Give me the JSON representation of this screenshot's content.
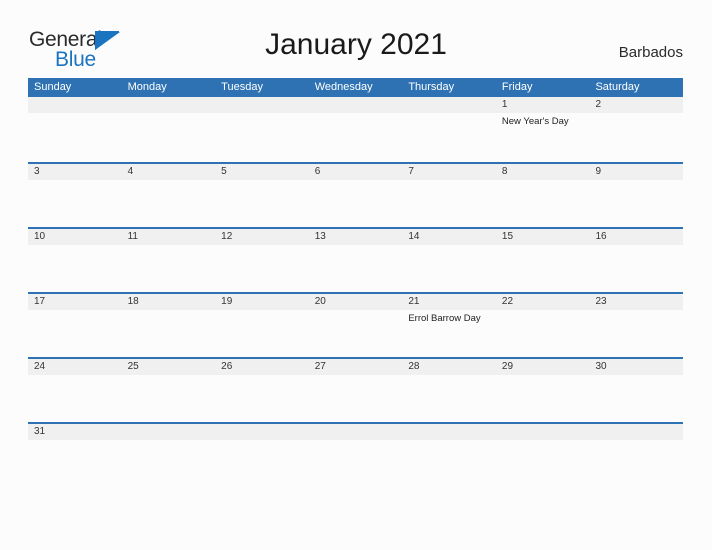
{
  "brand": {
    "name_part1": "General",
    "name_part2": "Blue",
    "flag_icon": "triangle-flag-icon",
    "flag_color": "#1a74c0",
    "text_color": "#2b2b2b"
  },
  "header": {
    "month_title": "January 2021",
    "country": "Barbados"
  },
  "theme": {
    "header_blue": "#2e72b4",
    "date_band_gray": "#f0f0f0",
    "page_background": "#fcfcfc",
    "text_color": "#222222"
  },
  "calendar": {
    "weekday_headers": [
      "Sunday",
      "Monday",
      "Tuesday",
      "Wednesday",
      "Thursday",
      "Friday",
      "Saturday"
    ],
    "weeks": [
      {
        "days": [
          {
            "num": "",
            "events": []
          },
          {
            "num": "",
            "events": []
          },
          {
            "num": "",
            "events": []
          },
          {
            "num": "",
            "events": []
          },
          {
            "num": "",
            "events": []
          },
          {
            "num": "1",
            "events": [
              "New Year's Day"
            ]
          },
          {
            "num": "2",
            "events": []
          }
        ]
      },
      {
        "days": [
          {
            "num": "3",
            "events": []
          },
          {
            "num": "4",
            "events": []
          },
          {
            "num": "5",
            "events": []
          },
          {
            "num": "6",
            "events": []
          },
          {
            "num": "7",
            "events": []
          },
          {
            "num": "8",
            "events": []
          },
          {
            "num": "9",
            "events": []
          }
        ]
      },
      {
        "days": [
          {
            "num": "10",
            "events": []
          },
          {
            "num": "11",
            "events": []
          },
          {
            "num": "12",
            "events": []
          },
          {
            "num": "13",
            "events": []
          },
          {
            "num": "14",
            "events": []
          },
          {
            "num": "15",
            "events": []
          },
          {
            "num": "16",
            "events": []
          }
        ]
      },
      {
        "days": [
          {
            "num": "17",
            "events": []
          },
          {
            "num": "18",
            "events": []
          },
          {
            "num": "19",
            "events": []
          },
          {
            "num": "20",
            "events": []
          },
          {
            "num": "21",
            "events": [
              "Errol Barrow Day"
            ]
          },
          {
            "num": "22",
            "events": []
          },
          {
            "num": "23",
            "events": []
          }
        ]
      },
      {
        "days": [
          {
            "num": "24",
            "events": []
          },
          {
            "num": "25",
            "events": []
          },
          {
            "num": "26",
            "events": []
          },
          {
            "num": "27",
            "events": []
          },
          {
            "num": "28",
            "events": []
          },
          {
            "num": "29",
            "events": []
          },
          {
            "num": "30",
            "events": []
          }
        ]
      },
      {
        "days": [
          {
            "num": "31",
            "events": []
          },
          {
            "num": "",
            "events": []
          },
          {
            "num": "",
            "events": []
          },
          {
            "num": "",
            "events": []
          },
          {
            "num": "",
            "events": []
          },
          {
            "num": "",
            "events": []
          },
          {
            "num": "",
            "events": []
          }
        ]
      }
    ]
  }
}
